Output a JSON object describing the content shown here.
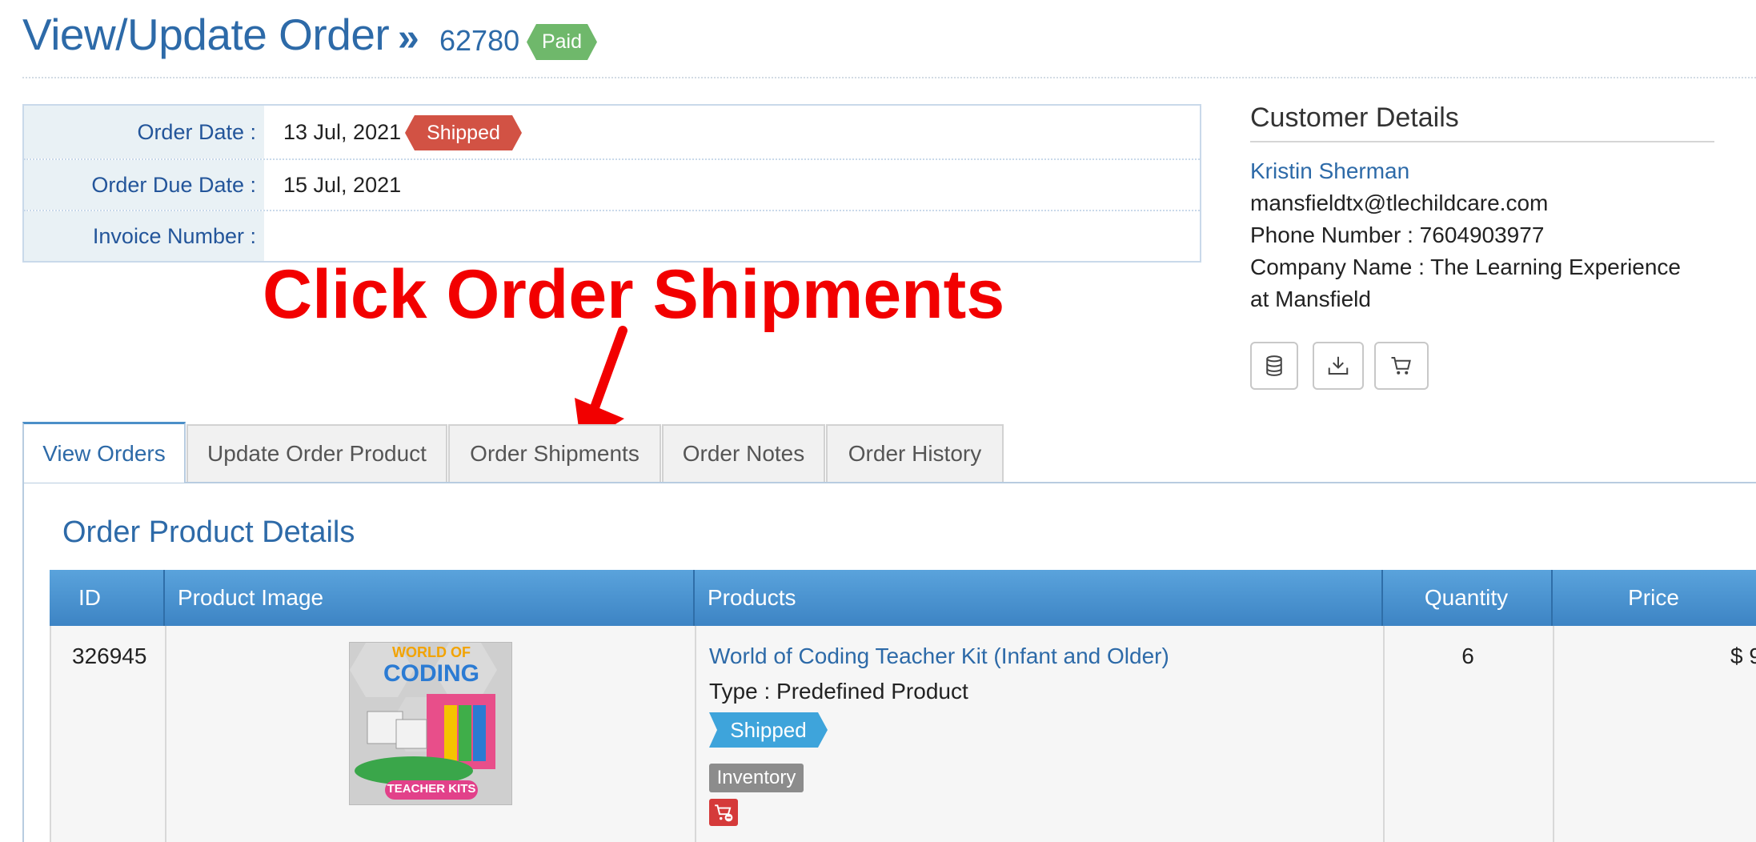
{
  "header": {
    "title": "View/Update Order",
    "separator": "»",
    "order_number": "62780",
    "payment_status": "Paid"
  },
  "order_info": {
    "rows": [
      {
        "label": "Order Date :",
        "value": "13 Jul, 2021",
        "status": "Shipped"
      },
      {
        "label": "Order Due Date :",
        "value": "15 Jul, 2021"
      },
      {
        "label": "Invoice Number :",
        "value": ""
      }
    ]
  },
  "annotation": {
    "text": "Click Order Shipments"
  },
  "customer": {
    "section_title": "Customer Details",
    "name": "Kristin Sherman",
    "email": "mansfieldtx@tlechildcare.com",
    "phone": "Phone Number : 7604903977",
    "company_line1": "Company Name : The Learning Experience",
    "company_line2": "at Mansfield",
    "actions": [
      {
        "icon": "database-icon"
      },
      {
        "icon": "download-icon"
      },
      {
        "icon": "cart-icon"
      }
    ]
  },
  "tabs": [
    {
      "label": "View Orders",
      "active": true
    },
    {
      "label": "Update Order Product",
      "active": false
    },
    {
      "label": "Order Shipments",
      "active": false
    },
    {
      "label": "Order Notes",
      "active": false
    },
    {
      "label": "Order History",
      "active": false
    }
  ],
  "section": {
    "title": "Order Product Details"
  },
  "product_table": {
    "columns": [
      "ID",
      "Product Image",
      "Products",
      "Quantity",
      "Price"
    ],
    "rows": [
      {
        "id": "326945",
        "image_alt": "World of Coding Teacher Kits",
        "image_text_top": "WORLD OF",
        "image_text_main": "CODING",
        "image_text_bottom": "TEACHER KITS",
        "product_name": "World of Coding Teacher Kit (Infant and Older)",
        "type_label": "Type :",
        "type_value": "Predefined Product",
        "status": "Shipped",
        "inventory_label": "Inventory",
        "quantity": "6",
        "price": "$ 9"
      }
    ]
  },
  "colors": {
    "primary": "#2d6aa8",
    "paid": "#6fb86b",
    "shipped_red": "#d25244",
    "shipped_blue": "#3ea4db",
    "annotation": "#f20000"
  }
}
